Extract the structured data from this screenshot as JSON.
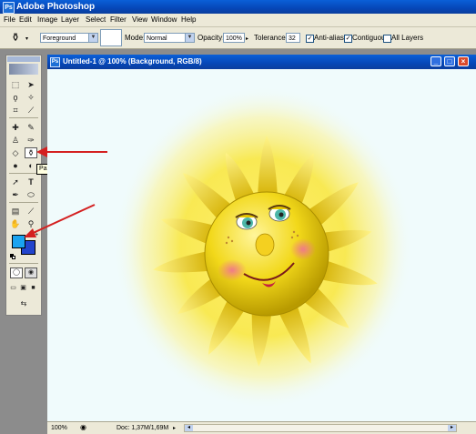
{
  "app": {
    "title": "Adobe Photoshop",
    "icon_letter": "Ps"
  },
  "menu": [
    "File",
    "Edit",
    "Image",
    "Layer",
    "Select",
    "Filter",
    "View",
    "Window",
    "Help"
  ],
  "options": {
    "fill_value": "Foreground",
    "mode_label": "Mode:",
    "mode_value": "Normal",
    "opacity_label": "Opacity:",
    "opacity_value": "100%",
    "tolerance_label": "Tolerance:",
    "tolerance_value": "32",
    "antialias_label": "Anti-alias",
    "antialias_checked": true,
    "contiguous_label": "Contiguous",
    "contiguous_checked": true,
    "all_layers_label": "All Layers",
    "all_layers_checked": false
  },
  "tooltip": "Paint Bucket Tool (G)",
  "colors": {
    "foreground": "#1aa3f0",
    "background": "#2244cc",
    "accent_red": "#d42020"
  },
  "document": {
    "title": "Untitled-1 @ 100% (Background, RGB/8)",
    "zoom": "100%",
    "doc_info": "Doc: 1,37M/1,69M"
  },
  "icons": {
    "tools": [
      "marquee-tool-icon",
      "move-tool-icon",
      "lasso-tool-icon",
      "magic-wand-tool-icon",
      "crop-tool-icon",
      "slice-tool-icon",
      "healing-brush-tool-icon",
      "brush-tool-icon",
      "clone-stamp-tool-icon",
      "history-brush-tool-icon",
      "eraser-tool-icon",
      "paint-bucket-tool-icon",
      "blur-tool-icon",
      "dodge-tool-icon",
      "path-selection-tool-icon",
      "type-tool-icon",
      "pen-tool-icon",
      "shape-tool-icon",
      "notes-tool-icon",
      "eyedropper-tool-icon",
      "hand-tool-icon",
      "zoom-tool-icon"
    ]
  }
}
